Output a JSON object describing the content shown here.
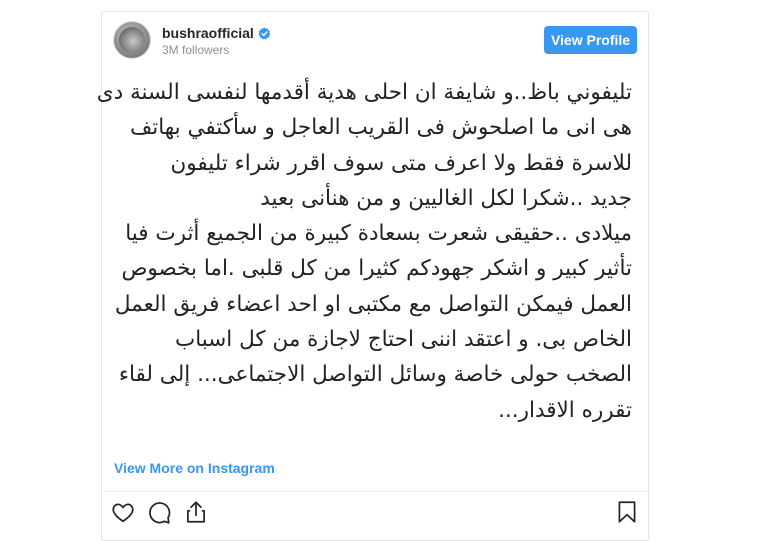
{
  "post": {
    "username": "bushraofficial",
    "followers": "3M followers",
    "view_profile_label": "View Profile",
    "text_lines": [
      "تليفوني باظ..و شايفة ان احلى هدية أقدمها لنفسى السنة دى",
      "هى انى ما اصلحوش  فى القريب العاجل و سأكتفي بهاتف",
      "للاسرة فقط ولا اعرف متى سوف اقرر  شراء تليفون",
      "جديد ..شكرا لكل  الغاليين  و من هنأنى بعيد",
      "ميلادى ..حقيقى شعرت بسعادة كبيرة من الجميع أثرت فيا",
      "تأثير كبير  و اشكر جهودكم كثيرا من كل قلبى .اما بخصوص",
      "العمل فيمكن التواصل مع مكتبى او احد اعضاء فريق العمل",
      "الخاص بى. و اعتقد اننى احتاج لاجازة من كل اسباب",
      "الصخب حولى خاصة وسائل التواصل الاجتماعى... إلى لقاء",
      "تقرره الاقدار..."
    ],
    "view_more_label": "View More on Instagram",
    "icons": {
      "verified": "verified-badge-icon",
      "like": "heart-icon",
      "comment": "comment-icon",
      "share": "share-icon",
      "save": "bookmark-icon"
    },
    "colors": {
      "accent": "#3897f0",
      "text": "#262626",
      "muted": "#8e8e8e"
    }
  }
}
